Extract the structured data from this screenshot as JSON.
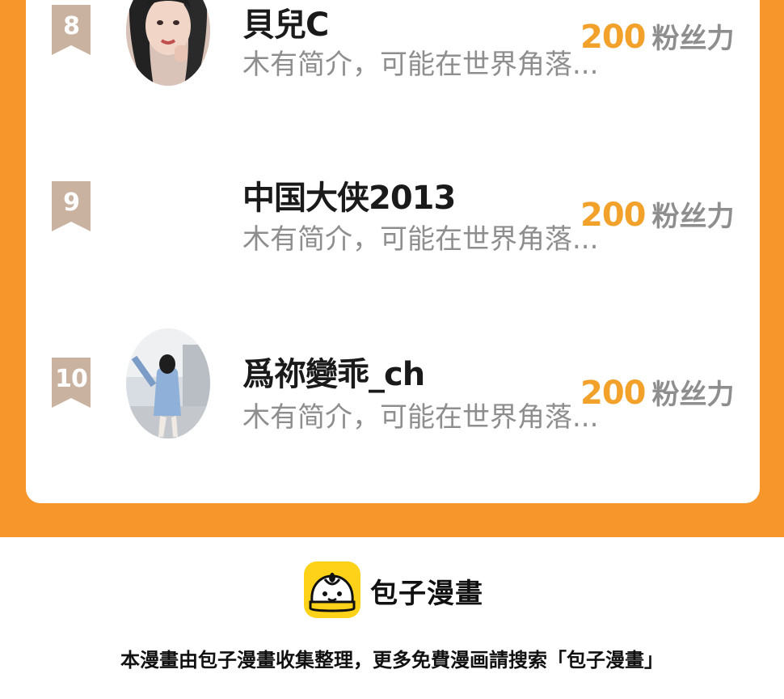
{
  "leaderboard": {
    "rows": [
      {
        "rank": "8",
        "name": "貝兒C",
        "bio": "木有简介，可能在世界角落...",
        "score": "200",
        "score_unit": "粉丝力",
        "avatar": "photo"
      },
      {
        "rank": "9",
        "name": "中国大侠2013",
        "bio": "木有简介，可能在世界角落...",
        "score": "200",
        "score_unit": "粉丝力",
        "avatar": "none"
      },
      {
        "rank": "10",
        "name": "爲祢變乖_ch",
        "bio": "木有简介，可能在世界角落...",
        "score": "200",
        "score_unit": "粉丝力",
        "avatar": "photo"
      }
    ]
  },
  "footer": {
    "brand": "包子漫畫",
    "note": "本漫畫由包子漫畫收集整理，更多免費漫画請搜索「包子漫畫」",
    "logo_icon": "bun-logo-icon"
  },
  "colors": {
    "background_band": "#f7972b",
    "card": "#ffffff",
    "score": "#f2a12a",
    "rank_badge": "#c9b2a0",
    "muted_text": "#8e8e8e"
  }
}
